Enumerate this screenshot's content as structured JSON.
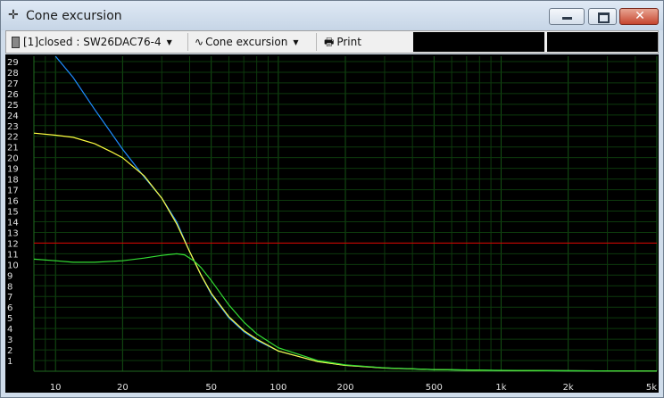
{
  "window": {
    "title": "Cone excursion"
  },
  "toolbar": {
    "project_label": "[1]closed : SW26DAC76-4",
    "graph_label": "Cone excursion",
    "print_label": "Print"
  },
  "icons": {
    "title": "crosshair-icon",
    "project": "speaker-icon",
    "graph": "sine-wave-icon",
    "print": "printer-icon"
  },
  "colors": {
    "background": "#000000",
    "grid": "#0d3a0d",
    "limit_line": "#e00000",
    "series_blue": "#1e8cff",
    "series_yellow": "#ffff40",
    "series_green": "#33dd33"
  },
  "chart_data": {
    "type": "line",
    "x_scale": "log",
    "xlim": [
      8,
      5000
    ],
    "ylim": [
      0,
      29.5
    ],
    "x_ticks": [
      10,
      20,
      50,
      100,
      200,
      500,
      1000,
      2000,
      5000
    ],
    "x_tick_labels": [
      "10",
      "20",
      "50",
      "100",
      "200",
      "500",
      "1k",
      "2k",
      "5k"
    ],
    "y_ticks": [
      1,
      2,
      3,
      4,
      5,
      6,
      7,
      8,
      9,
      10,
      11,
      12,
      13,
      14,
      15,
      16,
      17,
      18,
      19,
      20,
      21,
      22,
      23,
      24,
      25,
      26,
      27,
      28,
      29
    ],
    "y_tick_labels": [
      "1",
      "2",
      "3",
      "4",
      "5",
      "6",
      "7",
      "8",
      "9",
      "10",
      "11",
      "12",
      "13",
      "14",
      "15",
      "16",
      "17",
      "18",
      "19",
      "20",
      "21",
      "22",
      "23",
      "24",
      "25",
      "26",
      "27",
      "28",
      "29"
    ],
    "grid": true,
    "limit_line": 12,
    "series": [
      {
        "color": "#1e8cff",
        "points": [
          [
            10,
            29.5
          ],
          [
            12,
            27.5
          ],
          [
            15,
            24.5
          ],
          [
            20,
            20.8
          ],
          [
            25,
            18.2
          ],
          [
            30,
            16.2
          ],
          [
            35,
            14.0
          ],
          [
            40,
            11.2
          ],
          [
            45,
            9.0
          ],
          [
            50,
            7.2
          ],
          [
            60,
            5.0
          ],
          [
            70,
            3.7
          ],
          [
            80,
            2.9
          ],
          [
            100,
            1.9
          ],
          [
            150,
            0.9
          ],
          [
            200,
            0.55
          ],
          [
            300,
            0.3
          ],
          [
            500,
            0.15
          ],
          [
            1000,
            0.07
          ],
          [
            2000,
            0.04
          ],
          [
            5000,
            0.02
          ]
        ]
      },
      {
        "color": "#ffff40",
        "points": [
          [
            8,
            22.3
          ],
          [
            10,
            22.1
          ],
          [
            12,
            21.9
          ],
          [
            15,
            21.3
          ],
          [
            18,
            20.5
          ],
          [
            20,
            20.0
          ],
          [
            25,
            18.3
          ],
          [
            30,
            16.2
          ],
          [
            35,
            13.8
          ],
          [
            40,
            11.2
          ],
          [
            45,
            9.0
          ],
          [
            50,
            7.3
          ],
          [
            60,
            5.1
          ],
          [
            70,
            3.8
          ],
          [
            80,
            3.0
          ],
          [
            100,
            1.9
          ],
          [
            150,
            0.9
          ],
          [
            200,
            0.55
          ],
          [
            300,
            0.3
          ],
          [
            500,
            0.15
          ],
          [
            1000,
            0.07
          ],
          [
            2000,
            0.04
          ],
          [
            5000,
            0.02
          ]
        ]
      },
      {
        "color": "#33dd33",
        "points": [
          [
            8,
            10.5
          ],
          [
            10,
            10.35
          ],
          [
            12,
            10.2
          ],
          [
            15,
            10.2
          ],
          [
            20,
            10.35
          ],
          [
            25,
            10.6
          ],
          [
            30,
            10.85
          ],
          [
            35,
            11.0
          ],
          [
            38,
            10.9
          ],
          [
            42,
            10.3
          ],
          [
            45,
            9.7
          ],
          [
            50,
            8.5
          ],
          [
            60,
            6.2
          ],
          [
            70,
            4.6
          ],
          [
            80,
            3.5
          ],
          [
            100,
            2.2
          ],
          [
            150,
            1.0
          ],
          [
            200,
            0.6
          ],
          [
            300,
            0.32
          ],
          [
            500,
            0.16
          ],
          [
            1000,
            0.08
          ],
          [
            2000,
            0.04
          ],
          [
            5000,
            0.02
          ]
        ]
      }
    ]
  }
}
